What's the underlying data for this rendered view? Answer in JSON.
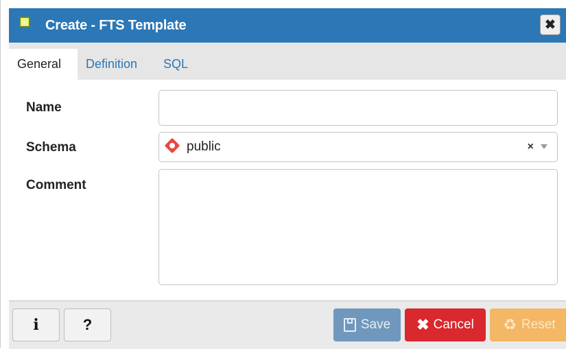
{
  "dialog": {
    "title": "Create - FTS Template",
    "close_label": "✖"
  },
  "tabs": [
    {
      "label": "General",
      "active": true
    },
    {
      "label": "Definition",
      "active": false
    },
    {
      "label": "SQL",
      "active": false
    }
  ],
  "form": {
    "name": {
      "label": "Name",
      "value": ""
    },
    "schema": {
      "label": "Schema",
      "value": "public",
      "clear": "×"
    },
    "comment": {
      "label": "Comment",
      "value": ""
    }
  },
  "footer": {
    "info_label": "i",
    "help_label": "?",
    "save_label": "Save",
    "cancel_label": "Cancel",
    "reset_label": "Reset",
    "cancel_icon": "✖",
    "reset_icon": "♻"
  },
  "colors": {
    "title_bar": "#2c77b5",
    "save": "#6f98bc",
    "cancel": "#d9282e",
    "reset": "#f3b765"
  }
}
